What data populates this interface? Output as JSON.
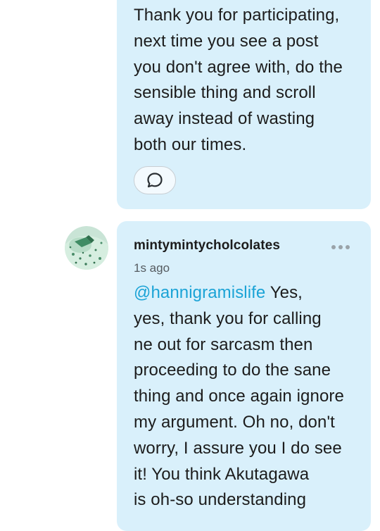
{
  "previous_comment": {
    "text": "Thank you for participating,\nnext time you see a post\nyou don't agree with, do the\nsensible thing and scroll\naway instead of wasting\nboth our times.",
    "reply_icon": "speech-bubble-icon"
  },
  "reply_comment": {
    "username": "mintymintycholcolates",
    "timestamp": "1s ago",
    "more_icon": "more-options-icon",
    "mention": "@hannigramislife",
    "text": " Yes,\nyes, thank you for calling\nne out for sarcasm then\nproceeding to do the sane\nthing and once again ignore\nmy argument. Oh no, don't\nworry, I assure you I do see\nit! You think Akutagawa\nis oh-so understanding",
    "avatar_icon": "mint-ice-cream-avatar"
  },
  "colors": {
    "bubble_background": "#d9f0fb",
    "mention": "#1ba3d6",
    "text": "#1c1c1c",
    "timestamp": "#555b60"
  }
}
